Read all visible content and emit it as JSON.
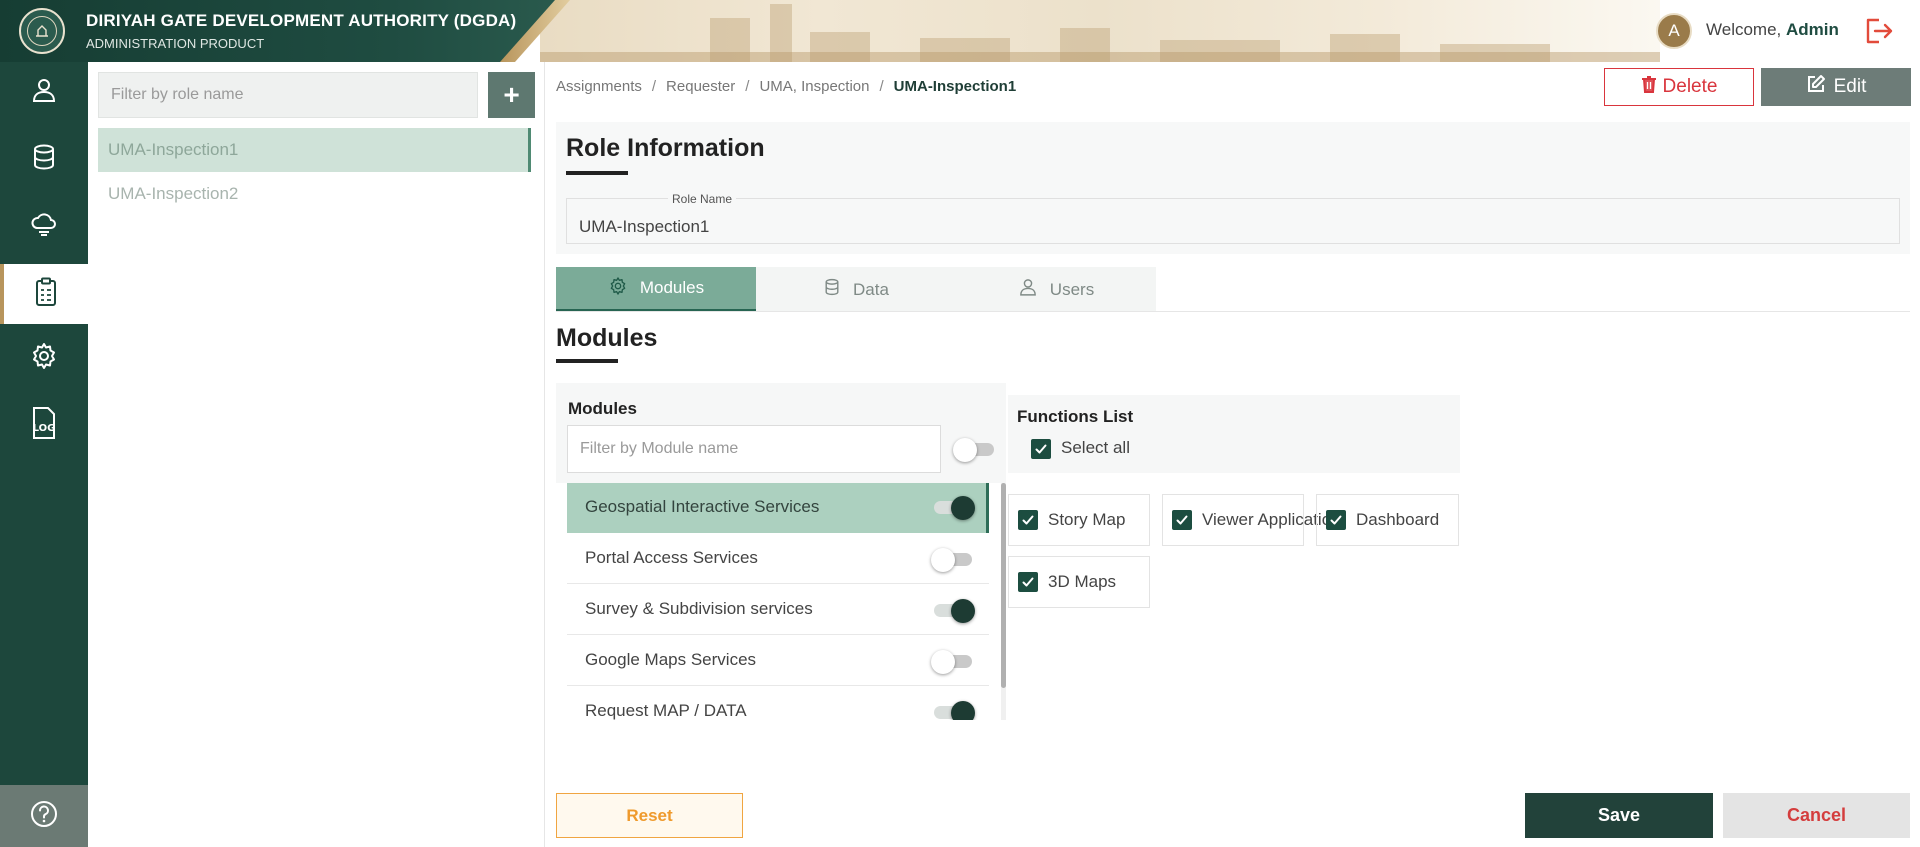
{
  "header": {
    "org_title": "DIRIYAH GATE DEVELOPMENT AUTHORITY (DGDA)",
    "org_subtitle": "ADMINISTRATION PRODUCT",
    "avatar_initial": "A",
    "welcome_prefix": "Welcome,",
    "user_name": "Admin"
  },
  "sidebar": {
    "items": [
      {
        "name": "user-icon"
      },
      {
        "name": "database-icon"
      },
      {
        "name": "cloud-icon"
      },
      {
        "name": "clipboard-icon",
        "active": true
      },
      {
        "name": "gear-icon"
      },
      {
        "name": "log-file-icon",
        "text": "LOG"
      }
    ],
    "help_icon": "help-circle-icon"
  },
  "roles": {
    "filter_placeholder": "Filter by role name",
    "add_label": "+",
    "items": [
      "UMA-Inspection1",
      "UMA-Inspection2"
    ],
    "selected": "UMA-Inspection1"
  },
  "breadcrumb": {
    "items": [
      "Assignments",
      "Requester",
      "UMA, Inspection"
    ],
    "current": "UMA-Inspection1",
    "separator": "/"
  },
  "actions": {
    "delete_label": "Delete",
    "edit_label": "Edit"
  },
  "role_info": {
    "title": "Role Information",
    "field_label": "Role Name",
    "field_value": "UMA-Inspection1"
  },
  "tabs": [
    {
      "label": "Modules",
      "icon": "gear-icon",
      "active": true
    },
    {
      "label": "Data",
      "icon": "database-icon",
      "active": false
    },
    {
      "label": "Users",
      "icon": "user-icon",
      "active": false
    }
  ],
  "modules_section": {
    "title": "Modules",
    "panel_title": "Modules",
    "filter_placeholder": "Filter by Module name",
    "master_toggle_on": false,
    "items": [
      {
        "label": "Geospatial Interactive Services",
        "on": true,
        "active": true
      },
      {
        "label": "Portal Access Services",
        "on": false,
        "active": false
      },
      {
        "label": "Survey & Subdivision services",
        "on": true,
        "active": false
      },
      {
        "label": "Google Maps Services",
        "on": false,
        "active": false
      },
      {
        "label": "Request MAP / DATA",
        "on": true,
        "active": false
      }
    ]
  },
  "functions": {
    "title": "Functions List",
    "select_all_label": "Select all",
    "select_all_checked": true,
    "items": [
      {
        "label": "Story Map",
        "checked": true
      },
      {
        "label": "Viewer Application",
        "checked": true
      },
      {
        "label": "Dashboard",
        "checked": true
      },
      {
        "label": "3D Maps",
        "checked": true
      }
    ]
  },
  "footer": {
    "reset_label": "Reset",
    "save_label": "Save",
    "cancel_label": "Cancel"
  },
  "colors": {
    "brand_green": "#1d473c",
    "accent_gold": "#b8955c",
    "active_tab": "#7bab98",
    "delete_red": "#d9353d",
    "reset_orange": "#ef9a2c"
  }
}
